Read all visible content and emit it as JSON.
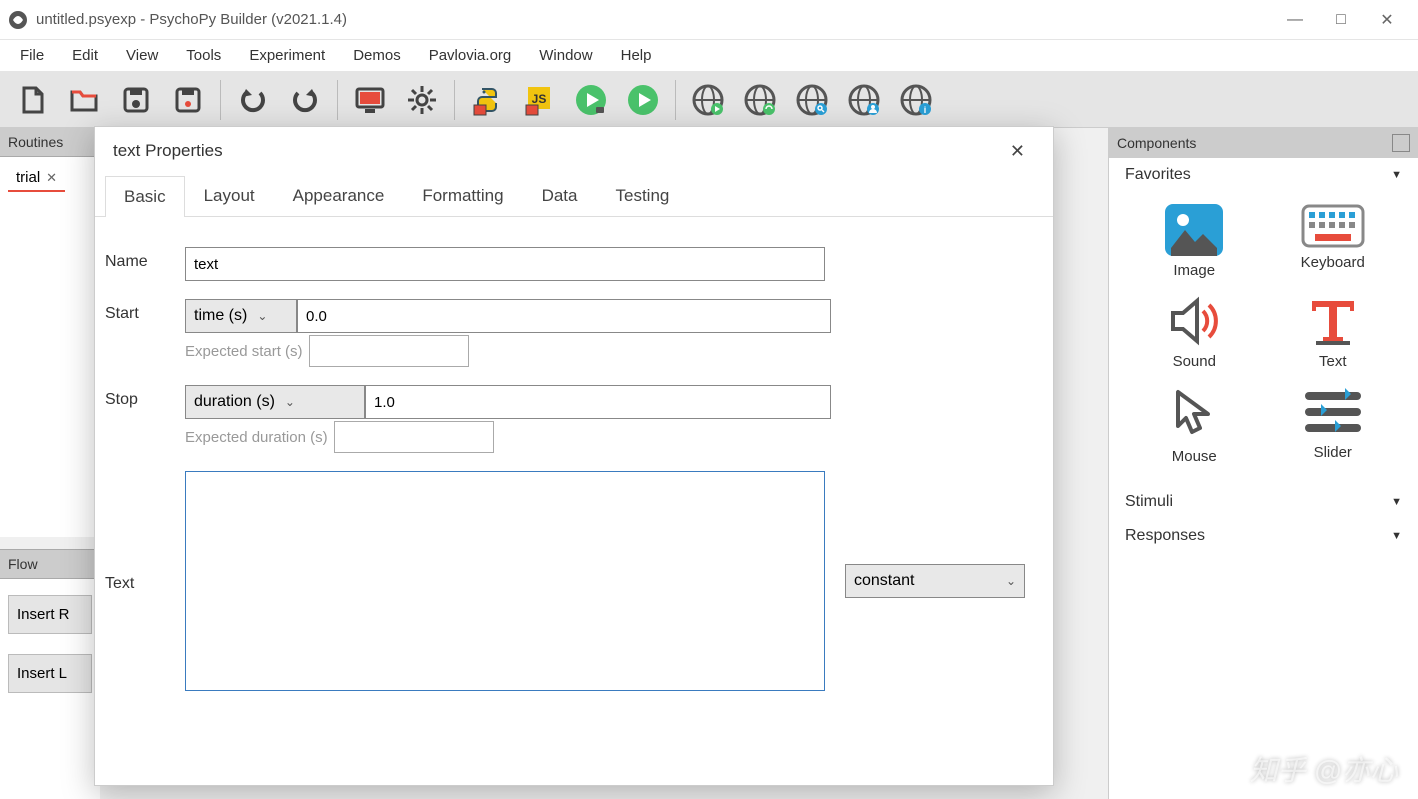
{
  "window": {
    "title": "untitled.psyexp - PsychoPy Builder (v2021.1.4)",
    "minimize": "—",
    "maximize": "□",
    "close": "✕"
  },
  "menu": [
    "File",
    "Edit",
    "View",
    "Tools",
    "Experiment",
    "Demos",
    "Pavlovia.org",
    "Window",
    "Help"
  ],
  "panels": {
    "routines": "Routines",
    "flow": "Flow",
    "components": "Components"
  },
  "routines_tab": {
    "label": "trial",
    "close": "✕"
  },
  "flow_buttons": [
    "Insert R",
    "Insert L"
  ],
  "dialog": {
    "title": "text Properties",
    "close": "✕",
    "tabs": [
      "Basic",
      "Layout",
      "Appearance",
      "Formatting",
      "Data",
      "Testing"
    ],
    "active_tab": 0,
    "fields": {
      "name_label": "Name",
      "name_value": "text",
      "start_label": "Start",
      "start_type": "time (s)",
      "start_value": "0.0",
      "start_expected_label": "Expected start (s)",
      "start_expected_value": "",
      "stop_label": "Stop",
      "stop_type": "duration (s)",
      "stop_value": "1.0",
      "stop_expected_label": "Expected duration (s)",
      "stop_expected_value": "",
      "text_label": "Text",
      "text_value": "",
      "text_update": "constant"
    }
  },
  "components": {
    "sections": [
      "Favorites",
      "Stimuli",
      "Responses"
    ],
    "favorites": [
      {
        "name": "Image"
      },
      {
        "name": "Keyboard"
      },
      {
        "name": "Sound"
      },
      {
        "name": "Text"
      },
      {
        "name": "Mouse"
      },
      {
        "name": "Slider"
      }
    ]
  },
  "watermark": "知乎 @亦心"
}
